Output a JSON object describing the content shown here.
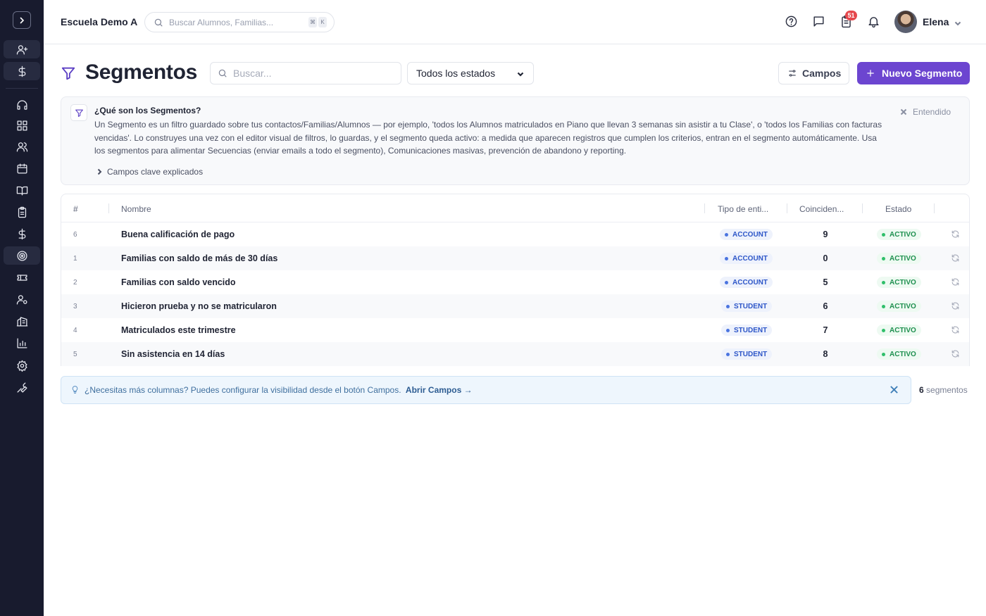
{
  "topbar": {
    "school_name": "Escuela Demo A",
    "search_placeholder": "Buscar Alumnos, Familias...",
    "kbd_1": "⌘",
    "kbd_2": "K",
    "notifications_badge": "51",
    "user_name": "Elena"
  },
  "sidebar": {
    "items": [
      "add-user",
      "billing",
      "support",
      "dashboard",
      "contacts",
      "calendar",
      "courses",
      "tasks",
      "payments",
      "segments",
      "tickets",
      "staff",
      "buildings",
      "reports",
      "settings",
      "tools"
    ],
    "active": "segments"
  },
  "header": {
    "title": "Segmentos",
    "search_placeholder": "Buscar...",
    "status_filter": "Todos los estados",
    "fields_button": "Campos",
    "new_button": "Nuevo Segmento"
  },
  "info": {
    "title": "¿Qué son los Segmentos?",
    "body": "Un Segmento es un filtro guardado sobre tus contactos/Familias/Alumnos — por ejemplo, 'todos los Alumnos matriculados en Piano que llevan 3 semanas sin asistir a tu Clase', o 'todos los Familias con facturas vencidas'. Lo construyes una vez con el editor visual de filtros, lo guardas, y el segmento queda activo: a medida que aparecen registros que cumplen los criterios, entran en el segmento automáticamente. Usa los segmentos para alimentar Secuencias (enviar emails a todo el segmento), Comunicaciones masivas, prevención de abandono y reporting.",
    "expand_label": "Campos clave explicados",
    "dismiss_label": "Entendido"
  },
  "table": {
    "columns": {
      "num": "#",
      "name": "Nombre",
      "type": "Tipo de enti...",
      "matches": "Coinciden...",
      "status": "Estado"
    },
    "rows": [
      {
        "num": "6",
        "name": "Buena calificación de pago",
        "type": "ACCOUNT",
        "matches": "9",
        "status": "ACTIVO"
      },
      {
        "num": "1",
        "name": "Familias con saldo de más de 30 días",
        "type": "ACCOUNT",
        "matches": "0",
        "status": "ACTIVO"
      },
      {
        "num": "2",
        "name": "Familias con saldo vencido",
        "type": "ACCOUNT",
        "matches": "5",
        "status": "ACTIVO"
      },
      {
        "num": "3",
        "name": "Hicieron prueba y no se matricularon",
        "type": "STUDENT",
        "matches": "6",
        "status": "ACTIVO"
      },
      {
        "num": "4",
        "name": "Matriculados este trimestre",
        "type": "STUDENT",
        "matches": "7",
        "status": "ACTIVO"
      },
      {
        "num": "5",
        "name": "Sin asistencia en 14 días",
        "type": "STUDENT",
        "matches": "8",
        "status": "ACTIVO"
      }
    ]
  },
  "hint": {
    "text": "¿Necesitas más columnas? Puedes configurar la visibilidad desde el botón Campos.",
    "link": "Abrir Campos →"
  },
  "footer": {
    "count": "6",
    "count_label": "segmentos"
  },
  "colors": {
    "sidebar_bg": "#181b2e",
    "accent": "#6c45d0",
    "account_tag": "#2d56c8",
    "student_tag": "#2d56c8",
    "active_status": "#1d8f4e",
    "badge": "#e5484d"
  }
}
